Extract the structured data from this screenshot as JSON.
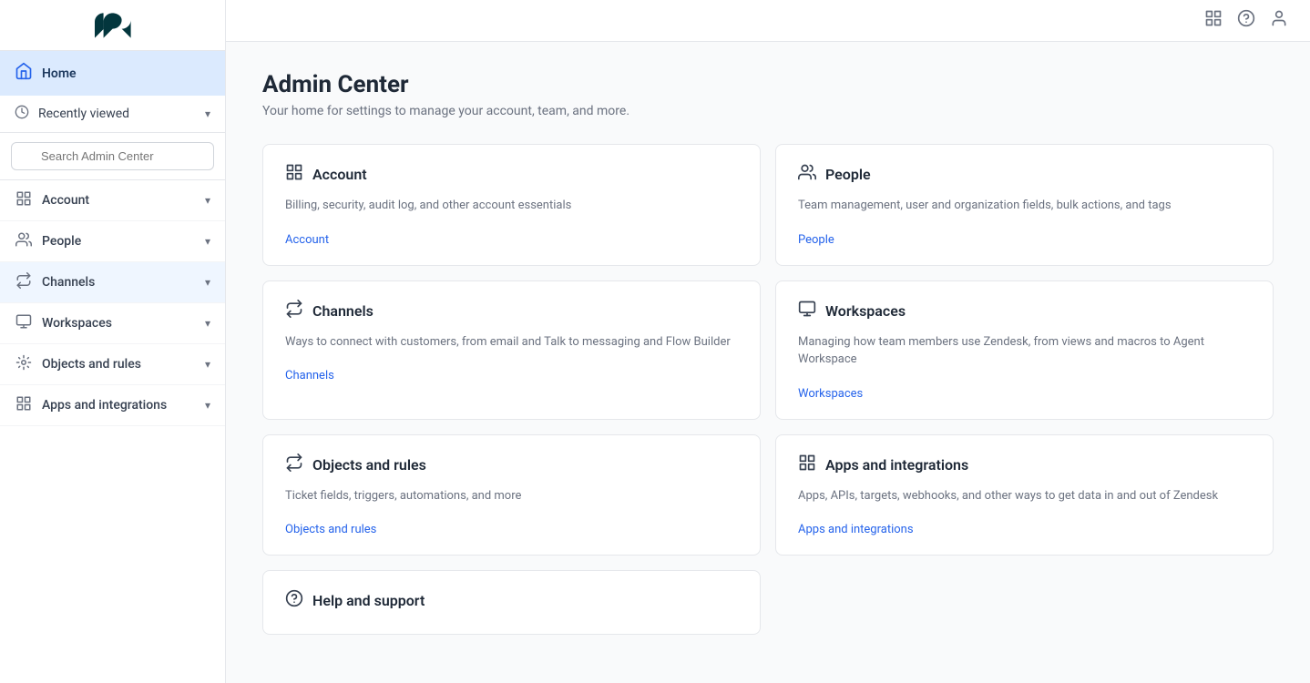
{
  "logo": {
    "alt": "Zendesk"
  },
  "sidebar": {
    "home_label": "Home",
    "recently_viewed_label": "Recently viewed",
    "search_placeholder": "Search Admin Center",
    "nav_items": [
      {
        "id": "account",
        "label": "Account",
        "icon": "grid"
      },
      {
        "id": "people",
        "label": "People",
        "icon": "people"
      },
      {
        "id": "channels",
        "label": "Channels",
        "icon": "channels",
        "active": true
      },
      {
        "id": "workspaces",
        "label": "Workspaces",
        "icon": "monitor"
      },
      {
        "id": "objects-rules",
        "label": "Objects and rules",
        "icon": "objects"
      },
      {
        "id": "apps-integrations",
        "label": "Apps and integrations",
        "icon": "apps"
      }
    ]
  },
  "topbar": {
    "apps_icon": "apps",
    "help_icon": "help",
    "user_icon": "user"
  },
  "main": {
    "page_title": "Admin Center",
    "page_subtitle": "Your home for settings to manage your account, team, and more.",
    "cards": [
      {
        "id": "account",
        "icon": "account",
        "title": "Account",
        "desc": "Billing, security, audit log, and other account essentials",
        "link_label": "Account"
      },
      {
        "id": "people",
        "icon": "people",
        "title": "People",
        "desc": "Team management, user and organization fields, bulk actions, and tags",
        "link_label": "People"
      },
      {
        "id": "channels",
        "icon": "channels",
        "title": "Channels",
        "desc": "Ways to connect with customers, from email and Talk to messaging and Flow Builder",
        "link_label": "Channels"
      },
      {
        "id": "workspaces",
        "icon": "workspaces",
        "title": "Workspaces",
        "desc": "Managing how team members use Zendesk, from views and macros to Agent Workspace",
        "link_label": "Workspaces"
      },
      {
        "id": "objects-rules",
        "icon": "objects",
        "title": "Objects and rules",
        "desc": "Ticket fields, triggers, automations, and more",
        "link_label": "Objects and rules"
      },
      {
        "id": "apps-integrations",
        "icon": "apps",
        "title": "Apps and integrations",
        "desc": "Apps, APIs, targets, webhooks, and other ways to get data in and out of Zendesk",
        "link_label": "Apps and integrations"
      },
      {
        "id": "help-support",
        "icon": "help",
        "title": "Help and support",
        "desc": "",
        "link_label": ""
      }
    ]
  }
}
